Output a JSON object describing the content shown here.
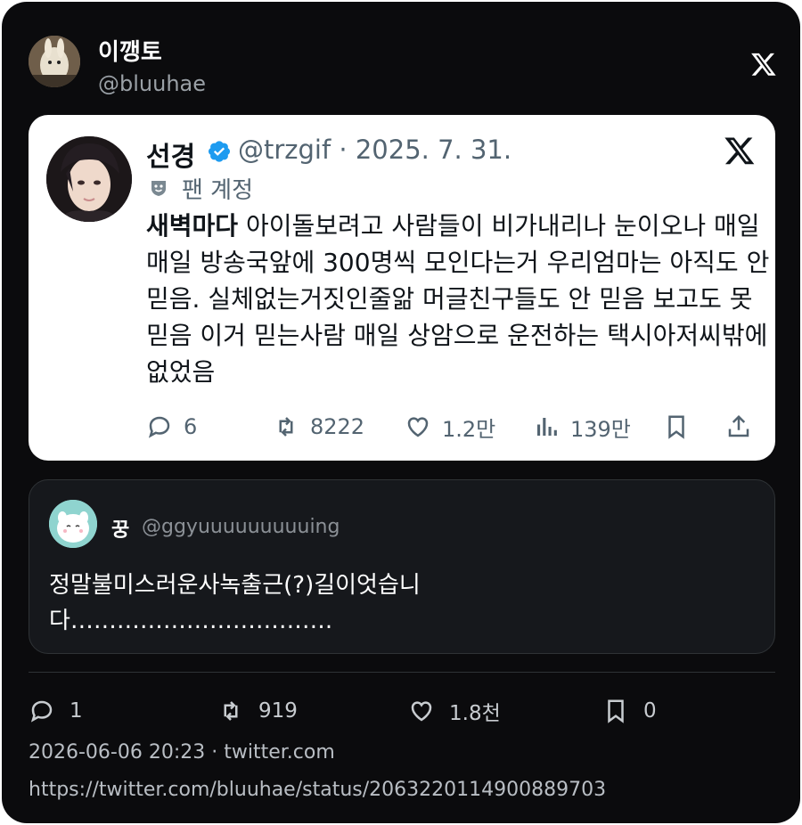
{
  "author": {
    "display_name": "이깽토",
    "handle": "@bluuhae"
  },
  "embedded_tweet": {
    "name": "선경",
    "handle_date": "@trzgif · 2025. 7. 31.",
    "badge_label": "팬 계정",
    "text_bold": "새벽마다",
    "text_rest": " 아이돌보려고 사람들이 비가내리나 눈이오나 매일매일 방송국앞에 300명씩 모인다는거 우리엄마는 아직도 안 믿음. 실체없는거짓인줄앎 머글친구들도 안 믿음 보고도 못믿음  이거 믿는사람 매일 상암으로 운전하는 택시아저씨밖에없었음",
    "actions": {
      "replies": "6",
      "retweets": "8222",
      "likes": "1.2만",
      "views": "139만"
    }
  },
  "quoted_tweet": {
    "name": "꿍",
    "handle": "@ggyuuuuuuuuuing",
    "text": "정말불미스러운사녹출근(?)길이엇습니\n다……………………………."
  },
  "actions": {
    "replies": "1",
    "retweets": "919",
    "likes": "1.8천",
    "bookmarks": "0"
  },
  "footer": {
    "meta": "2026-06-06 20:23  ·  twitter.com",
    "url": "https://twitter.com/bluuhae/status/2063220114900889703"
  },
  "colors": {
    "background": "#0b0b0d",
    "verified_blue": "#1d9bf0",
    "muted_text": "#536471"
  },
  "icons": [
    "x-logo-icon",
    "verified-badge-icon",
    "fan-account-icon",
    "reply-icon",
    "retweet-icon",
    "like-icon",
    "views-icon",
    "bookmark-icon",
    "share-icon"
  ]
}
